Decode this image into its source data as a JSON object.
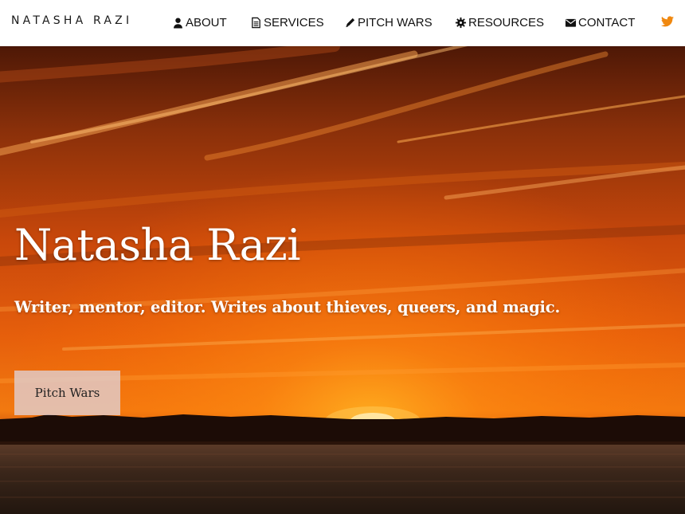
{
  "nav": {
    "brand": "NATASHA RAZI",
    "items": [
      {
        "label": "ABOUT",
        "icon": "user-icon"
      },
      {
        "label": "SERVICES",
        "icon": "document-icon"
      },
      {
        "label": "PITCH WARS",
        "icon": "pencil-icon"
      },
      {
        "label": "RESOURCES",
        "icon": "gear-icon"
      },
      {
        "label": "CONTACT",
        "icon": "envelope-icon"
      }
    ],
    "social_icon": "twitter-icon"
  },
  "hero": {
    "title": "Natasha Razi",
    "subtitle": "Writer, mentor, editor. Writes about thieves, queers, and magic.",
    "button_label": "Pitch Wars"
  },
  "colors": {
    "accent_orange": "#f0880f",
    "sky_top": "#5a1c08",
    "sky_mid": "#d8520c",
    "sky_glow": "#ff8a10",
    "water": "#3a2418"
  }
}
